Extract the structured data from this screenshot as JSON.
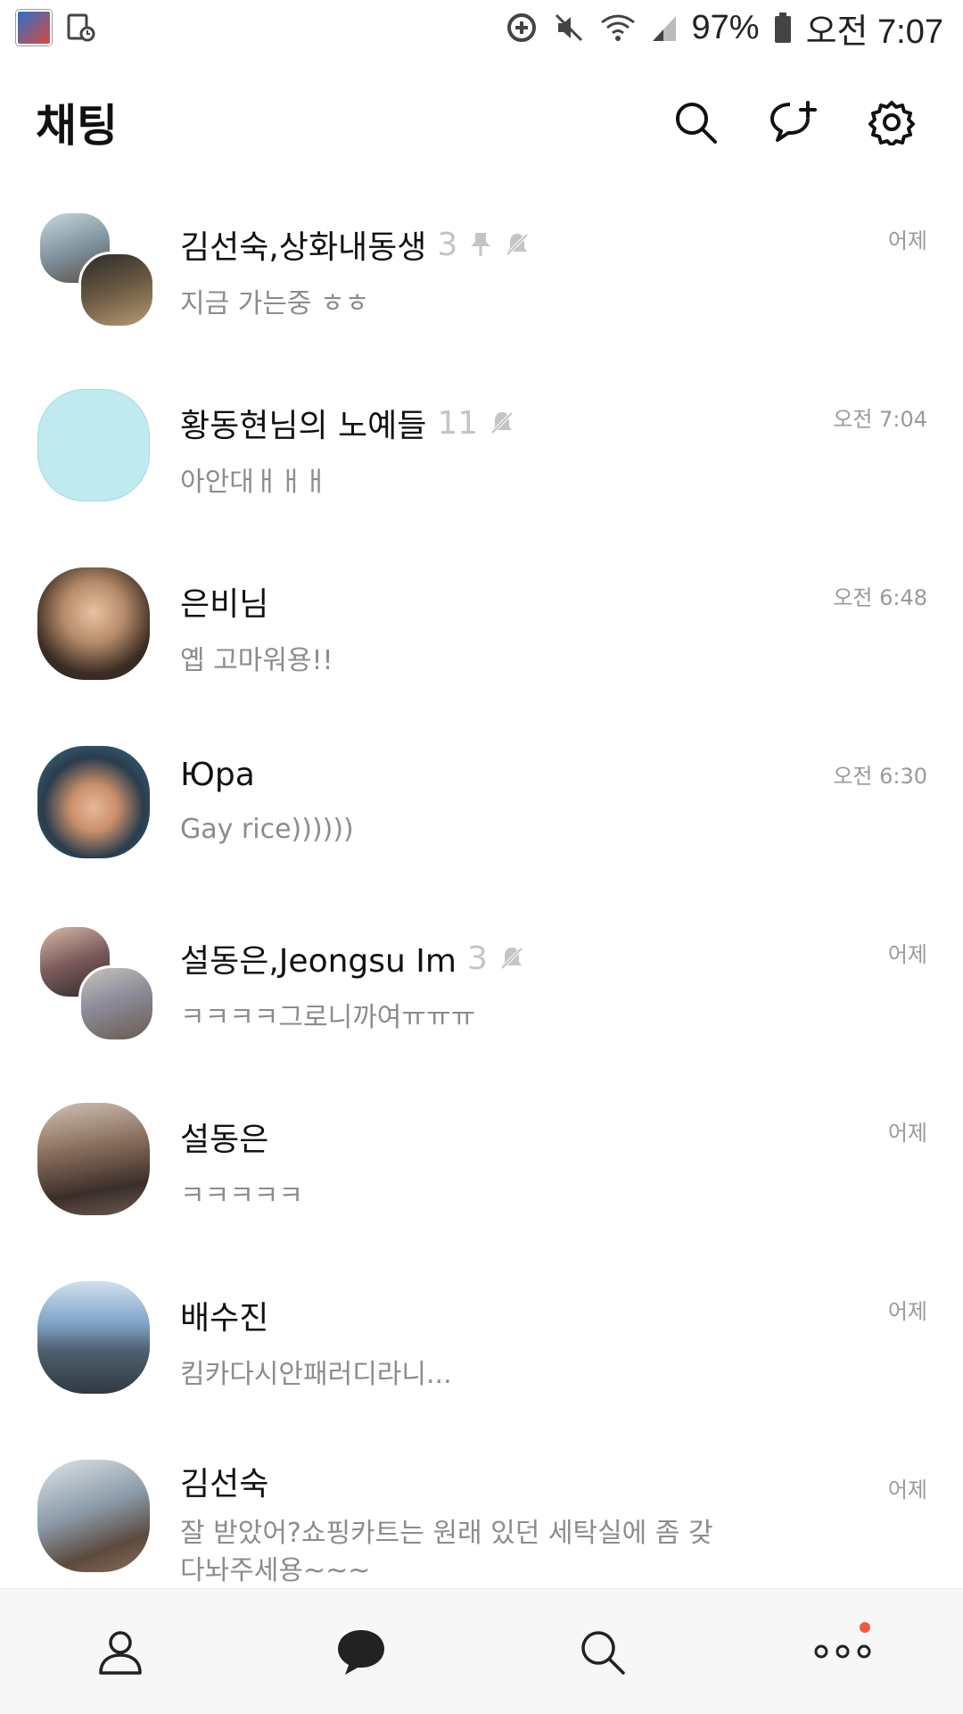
{
  "status_bar": {
    "battery_percent": "97%",
    "time": "오전 7:07"
  },
  "header": {
    "title": "채팅"
  },
  "chats": [
    {
      "name": "김선숙,상화내동생",
      "member_count": "3",
      "pinned": true,
      "muted": true,
      "time": "어제",
      "message": "지금 가는중 ㅎㅎ",
      "avatar_colors": [
        "#7a8f9a",
        "#6b5a43"
      ]
    },
    {
      "name": "황동현님의 노예들",
      "member_count": "11",
      "pinned": false,
      "muted": true,
      "time": "오전 7:04",
      "message": "아안대ㅐㅐㅐ",
      "avatar_colors": [
        "#bfeaf0"
      ]
    },
    {
      "name": "은비님",
      "member_count": "",
      "pinned": false,
      "muted": false,
      "time": "오전 6:48",
      "message": "옙 고마워용!!",
      "avatar_colors": [
        "#b58b6a"
      ]
    },
    {
      "name": "Юра",
      "member_count": "",
      "pinned": false,
      "muted": false,
      "time": "오전 6:30",
      "message": "Gay rice))))))",
      "avatar_colors": [
        "#3d6e8a"
      ]
    },
    {
      "name": "설동은,Jeongsu Im",
      "member_count": "3",
      "pinned": false,
      "muted": true,
      "time": "어제",
      "message": "ㅋㅋㅋㅋ그로니까여ㅠㅠㅠ",
      "avatar_colors": [
        "#7a5a5a",
        "#8c8c9a"
      ]
    },
    {
      "name": "설동은",
      "member_count": "",
      "pinned": false,
      "muted": false,
      "time": "어제",
      "message": "ㅋㅋㅋㅋㅋ",
      "avatar_colors": [
        "#6e5a4e"
      ]
    },
    {
      "name": "배수진",
      "member_count": "",
      "pinned": false,
      "muted": false,
      "time": "어제",
      "message": "킴카다시안패러디라니...",
      "avatar_colors": [
        "#7fa2c4"
      ]
    },
    {
      "name": "김선숙",
      "member_count": "",
      "pinned": false,
      "muted": false,
      "time": "어제",
      "message": "잘 받았어?쇼핑카트는 원래 있던 세탁실에 좀 갖다놔주세용~~~",
      "avatar_colors": [
        "#8a9aa8"
      ]
    }
  ],
  "bottom_nav": {
    "items": [
      {
        "icon": "person-icon"
      },
      {
        "icon": "chat-bubble-icon"
      },
      {
        "icon": "search-icon"
      },
      {
        "icon": "more-icon",
        "badge": true
      }
    ],
    "active": "chat-bubble-icon",
    "badge_color": "#f05a3c"
  }
}
